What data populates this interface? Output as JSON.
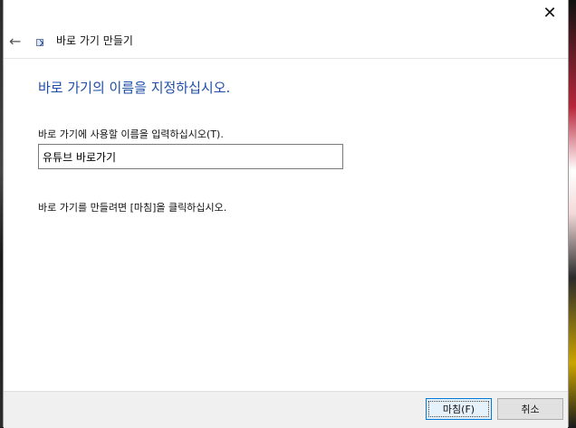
{
  "window": {
    "title": "바로 가기 만들기",
    "close_glyph": "✕"
  },
  "header": {
    "back_glyph": "←"
  },
  "main": {
    "heading": "바로 가기의 이름을 지정하십시오.",
    "field_label": "바로 가기에 사용할 이름을 입력하십시오(T).",
    "input_value": "유튜브 바로가기",
    "instruction": "바로 가기를 만들려면 [마침]을 클릭하십시오."
  },
  "footer": {
    "finish_label": "마침(F)",
    "cancel_label": "취소"
  },
  "icons": {
    "back": "arrow-left-icon",
    "shortcut": "shortcut-icon",
    "close": "close-icon"
  }
}
